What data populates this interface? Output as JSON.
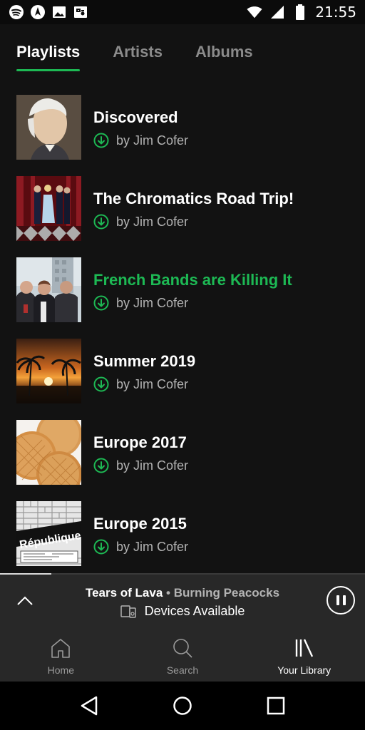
{
  "status_bar": {
    "time": "21:55",
    "left_icons": [
      "spotify-icon",
      "nav-icon",
      "image-icon",
      "maps-icon"
    ],
    "right_icons": [
      "wifi-icon",
      "signal-icon",
      "battery-icon"
    ]
  },
  "tabs": [
    {
      "label": "Playlists",
      "active": true
    },
    {
      "label": "Artists",
      "active": false
    },
    {
      "label": "Albums",
      "active": false
    }
  ],
  "playlists": [
    {
      "title": "Discovered",
      "subtitle": "by Jim Cofer",
      "playing": false
    },
    {
      "title": "The Chromatics Road Trip!",
      "subtitle": "by Jim Cofer",
      "playing": false
    },
    {
      "title": "French Bands are Killing It",
      "subtitle": "by Jim Cofer",
      "playing": true
    },
    {
      "title": "Summer 2019",
      "subtitle": "by Jim Cofer",
      "playing": false
    },
    {
      "title": "Europe 2017",
      "subtitle": "by Jim Cofer",
      "playing": false
    },
    {
      "title": "Europe 2015",
      "subtitle": "by Jim Cofer",
      "playing": false
    }
  ],
  "cover_text": {
    "europe_2015": "République"
  },
  "mini_player": {
    "track": "Tears of Lava",
    "separator": "•",
    "artist": "Burning Peacocks",
    "devices_label": "Devices Available",
    "progress": 0.14
  },
  "bottom_nav": [
    {
      "label": "Home",
      "icon": "home-icon",
      "active": false
    },
    {
      "label": "Search",
      "icon": "search-icon",
      "active": false
    },
    {
      "label": "Your Library",
      "icon": "library-icon",
      "active": true
    }
  ],
  "colors": {
    "accent": "#1db954",
    "background": "#121212",
    "player": "#282828"
  }
}
